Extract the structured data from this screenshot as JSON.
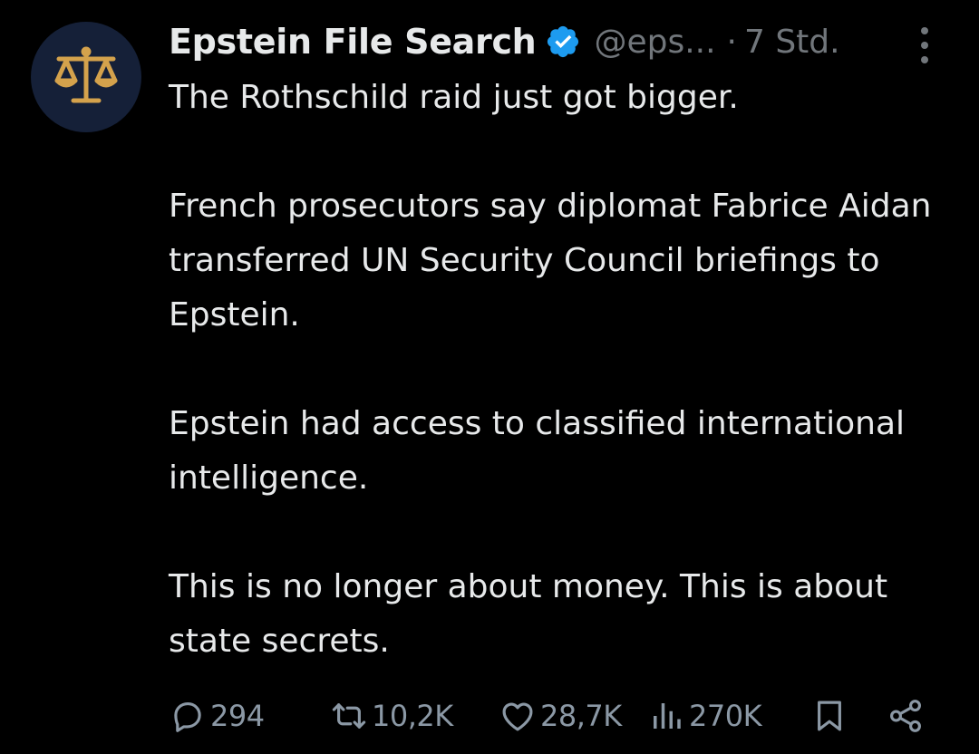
{
  "tweet": {
    "author": {
      "display_name": "Epstein File Search",
      "handle": "@eps...",
      "verified": true,
      "avatar_icon": "scales-of-justice-icon",
      "avatar_bg": "#152038",
      "avatar_fg": "#d4a24c"
    },
    "separator": "·",
    "timestamp": "7 Std.",
    "text": {
      "p1": "The Rothschild raid just got bigger.",
      "p2": "French prosecutors say diplomat Fabrice Aidan transferred UN Security Council briefings to Epstein.",
      "p3": "Epstein had access to classified international intelligence.",
      "p4": "This is no longer about money. This is about state secrets."
    },
    "actions": {
      "replies": "294",
      "reposts": "10,2K",
      "likes": "28,7K",
      "views": "270K"
    }
  },
  "colors": {
    "background": "#000000",
    "text": "#e7e9ea",
    "muted": "#71767b",
    "action": "#8b98a5",
    "verified_badge": "#1d9bf0"
  }
}
